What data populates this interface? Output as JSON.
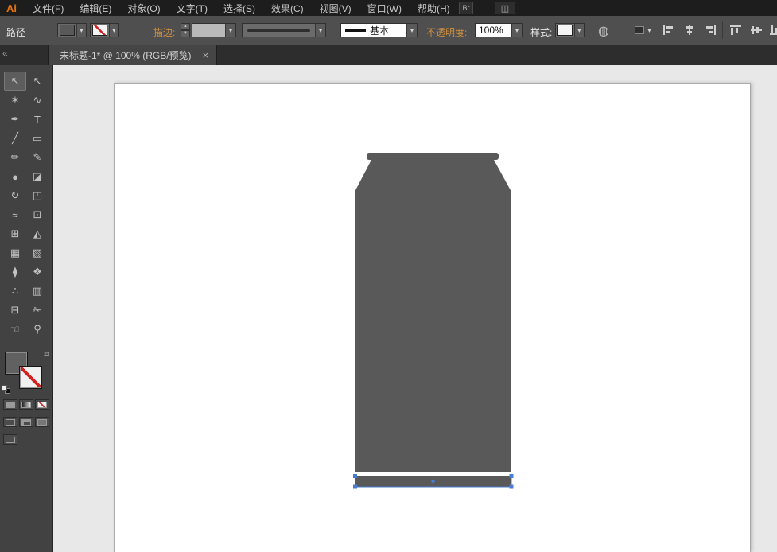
{
  "app": {
    "logo": "Ai"
  },
  "menu_bar": {
    "items": [
      {
        "name": "menu-file",
        "label": "文件(F)"
      },
      {
        "name": "menu-edit",
        "label": "编辑(E)"
      },
      {
        "name": "menu-object",
        "label": "对象(O)"
      },
      {
        "name": "menu-type",
        "label": "文字(T)"
      },
      {
        "name": "menu-select",
        "label": "选择(S)"
      },
      {
        "name": "menu-effect",
        "label": "效果(C)"
      },
      {
        "name": "menu-view",
        "label": "视图(V)"
      },
      {
        "name": "menu-window",
        "label": "窗口(W)"
      },
      {
        "name": "menu-help",
        "label": "帮助(H)"
      }
    ],
    "bridge_label": "Br",
    "arrange_glyph": "◫"
  },
  "control_bar": {
    "context_label": "路径",
    "stroke_label": "描边:",
    "stroke_style_value": "基本",
    "opacity_label": "不透明度:",
    "opacity_value": "100%",
    "style_label": "样式:",
    "stepper_up": "▲",
    "stepper_down": "▼",
    "dropdown_arrow": "▾",
    "doc_setup_glyph": "◍"
  },
  "tab_bar": {
    "collapse_glyph": "«",
    "tab_title": "未标题-1* @ 100% (RGB/预览)",
    "close_glyph": "×"
  },
  "toolbar": {
    "tools": [
      {
        "name": "selection-tool",
        "glyph": "↖"
      },
      {
        "name": "direct-selection-tool",
        "glyph": "↖"
      },
      {
        "name": "magic-wand-tool",
        "glyph": "✶"
      },
      {
        "name": "lasso-tool",
        "glyph": "∿"
      },
      {
        "name": "pen-tool",
        "glyph": "✒"
      },
      {
        "name": "type-tool",
        "glyph": "T"
      },
      {
        "name": "line-segment-tool",
        "glyph": "╱"
      },
      {
        "name": "rectangle-tool",
        "glyph": "▭"
      },
      {
        "name": "paintbrush-tool",
        "glyph": "✏"
      },
      {
        "name": "pencil-tool",
        "glyph": "✎"
      },
      {
        "name": "blob-brush-tool",
        "glyph": "●"
      },
      {
        "name": "eraser-tool",
        "glyph": "◪"
      },
      {
        "name": "rotate-tool",
        "glyph": "↻"
      },
      {
        "name": "scale-tool",
        "glyph": "◳"
      },
      {
        "name": "width-tool",
        "glyph": "≈"
      },
      {
        "name": "free-transform-tool",
        "glyph": "⊡"
      },
      {
        "name": "shape-builder-tool",
        "glyph": "⊞"
      },
      {
        "name": "perspective-grid-tool",
        "glyph": "◭"
      },
      {
        "name": "mesh-tool",
        "glyph": "▦"
      },
      {
        "name": "gradient-tool",
        "glyph": "▧"
      },
      {
        "name": "eyedropper-tool",
        "glyph": "⧫"
      },
      {
        "name": "blend-tool",
        "glyph": "❖"
      },
      {
        "name": "symbol-sprayer-tool",
        "glyph": "∴"
      },
      {
        "name": "column-graph-tool",
        "glyph": "▥"
      },
      {
        "name": "artboard-tool",
        "glyph": "⊟"
      },
      {
        "name": "slice-tool",
        "glyph": "✁"
      },
      {
        "name": "hand-tool",
        "glyph": "☜"
      },
      {
        "name": "zoom-tool",
        "glyph": "⚲"
      }
    ],
    "swap_glyph": "⇄"
  },
  "canvas": {
    "shape_color": "#595959",
    "selection_color": "#4a7dd2",
    "artboard_color": "#ffffff"
  }
}
